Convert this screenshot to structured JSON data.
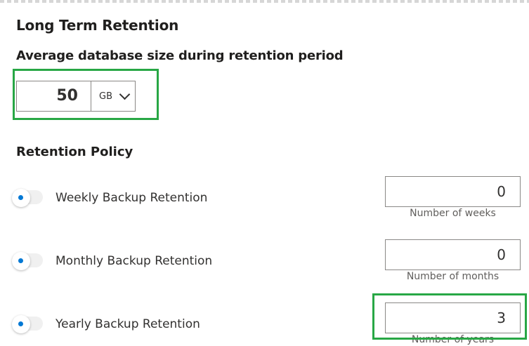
{
  "section_title": "Long Term Retention",
  "db_size": {
    "label": "Average database size during retention period",
    "value": "50",
    "unit": "GB"
  },
  "retention_policy": {
    "label": "Retention Policy",
    "rows": [
      {
        "label": "Weekly Backup Retention",
        "value": "0",
        "caption": "Number of weeks",
        "toggle_on": false
      },
      {
        "label": "Monthly Backup Retention",
        "value": "0",
        "caption": "Number of months",
        "toggle_on": false
      },
      {
        "label": "Yearly Backup Retention",
        "value": "3",
        "caption": "Number of years",
        "toggle_on": false
      }
    ]
  },
  "colors": {
    "highlight": "#28a745",
    "toggle_dot": "#0078d4"
  },
  "icons": {
    "unit_dropdown": "chevron-down-icon"
  }
}
